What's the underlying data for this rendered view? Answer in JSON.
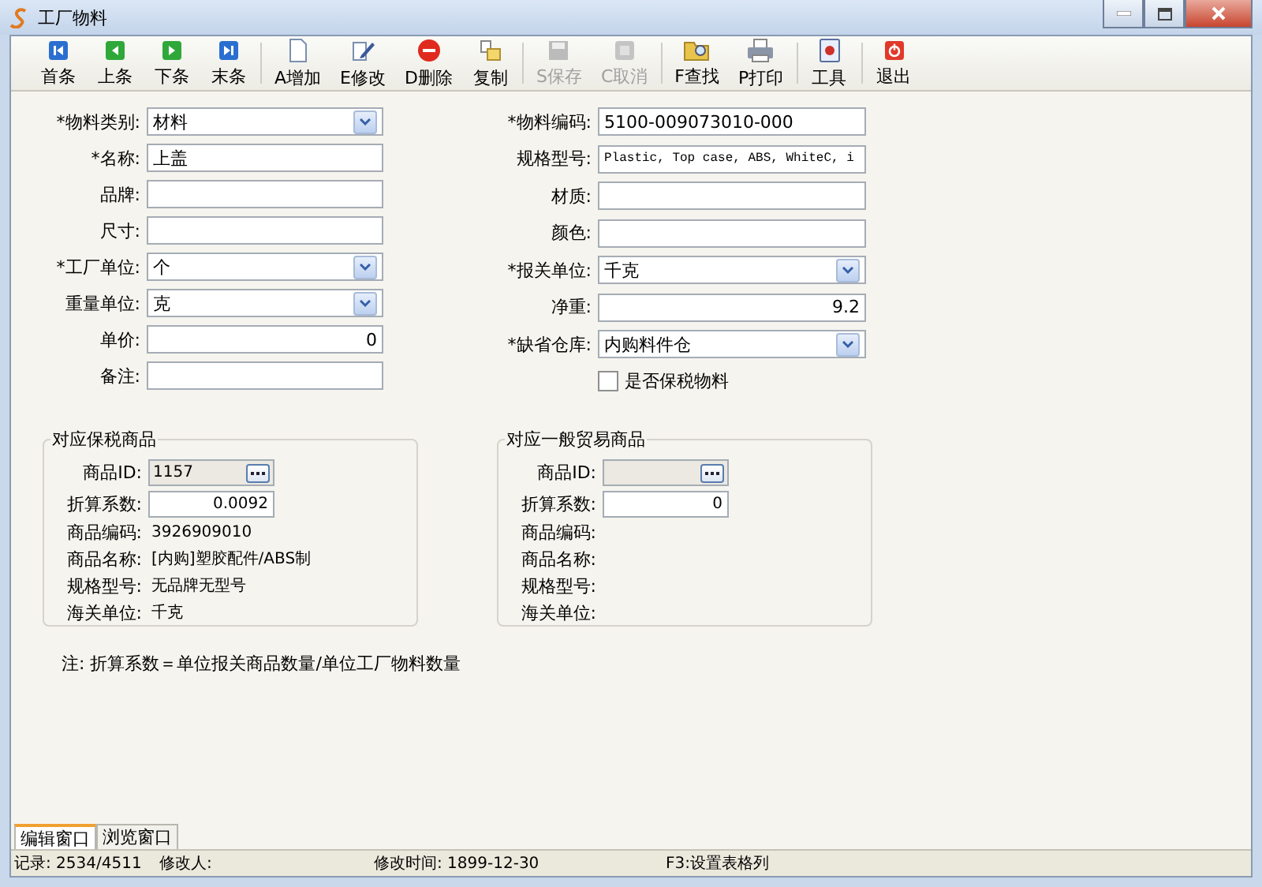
{
  "window": {
    "title": "工厂物料"
  },
  "toolbar": [
    {
      "label": "首条",
      "kind": "first",
      "disabled": false
    },
    {
      "label": "上条",
      "kind": "prev",
      "disabled": false
    },
    {
      "label": "下条",
      "kind": "next",
      "disabled": false
    },
    {
      "label": "末条",
      "kind": "last",
      "disabled": false
    },
    {
      "label": "A增加",
      "kind": "new",
      "disabled": false
    },
    {
      "label": "E修改",
      "kind": "edit",
      "disabled": false
    },
    {
      "label": "D删除",
      "kind": "delete",
      "disabled": false
    },
    {
      "label": "复制",
      "kind": "copy",
      "disabled": false
    },
    {
      "label": "S保存",
      "kind": "save",
      "disabled": true
    },
    {
      "label": "C取消",
      "kind": "cancel",
      "disabled": true
    },
    {
      "label": "F查找",
      "kind": "find",
      "disabled": false
    },
    {
      "label": "P打印",
      "kind": "print",
      "disabled": false
    },
    {
      "label": "工具",
      "kind": "tool",
      "disabled": false
    },
    {
      "label": "退出",
      "kind": "exit",
      "disabled": false
    }
  ],
  "left_fields": [
    {
      "label": "*物料类别:",
      "kind": "select",
      "value": "材料"
    },
    {
      "label": "*名称:",
      "kind": "text",
      "value": "上盖"
    },
    {
      "label": "品牌:",
      "kind": "text"
    },
    {
      "label": "尺寸:",
      "kind": "text"
    },
    {
      "label": "*工厂单位:",
      "kind": "select",
      "value": "个"
    },
    {
      "label": "重量单位:",
      "kind": "select",
      "value": "克"
    },
    {
      "label": "单价:",
      "kind": "number",
      "value": "0"
    },
    {
      "label": "备注:",
      "kind": "text"
    }
  ],
  "right_fields": [
    {
      "label": "*物料编码:",
      "kind": "text",
      "value": "5100-009073010-000"
    },
    {
      "label": "规格型号:",
      "kind": "mono",
      "value": "Plastic, Top case, ABS, WhiteC, i"
    },
    {
      "label": "材质:",
      "kind": "text"
    },
    {
      "label": "颜色:",
      "kind": "text"
    },
    {
      "label": "*报关单位:",
      "kind": "select",
      "value": "千克"
    },
    {
      "label": "净重:",
      "kind": "number",
      "value": "9.2"
    },
    {
      "label": "*缺省仓库:",
      "kind": "select",
      "value": "内购料件仓"
    },
    {
      "label": "是否保税物料",
      "kind": "checkbox",
      "checked": false
    }
  ],
  "groups": [
    {
      "title": "对应保税商品",
      "rows": [
        {
          "label": "商品ID:",
          "kind": "lookup",
          "value": "1157"
        },
        {
          "label": "折算系数:",
          "kind": "number",
          "value": "0.0092"
        },
        {
          "label": "商品编码:",
          "kind": "info",
          "value": "3926909010"
        },
        {
          "label": "商品名称:",
          "kind": "info",
          "value": "[内购]塑胶配件/ABS制"
        },
        {
          "label": "规格型号:",
          "kind": "info",
          "value": "无品牌无型号"
        },
        {
          "label": "海关单位:",
          "kind": "info",
          "value": "千克"
        }
      ]
    },
    {
      "title": "对应一般贸易商品",
      "rows": [
        {
          "label": "商品ID:",
          "kind": "lookup"
        },
        {
          "label": "折算系数:",
          "kind": "number",
          "value": "0"
        },
        {
          "label": "商品编码:",
          "kind": "info"
        },
        {
          "label": "商品名称:",
          "kind": "info"
        },
        {
          "label": "规格型号:",
          "kind": "info"
        },
        {
          "label": "海关单位:",
          "kind": "info"
        }
      ]
    }
  ],
  "note": "注: 折算系数＝单位报关商品数量/单位工厂物料数量",
  "bottom_tabs": [
    {
      "label": "编辑窗口",
      "selected": true
    },
    {
      "label": "浏览窗口",
      "selected": false
    }
  ],
  "status_bar": [
    "记录: 2534/4511",
    "修改人:",
    "修改时间: 1899-12-30",
    "F3:设置表格列"
  ]
}
